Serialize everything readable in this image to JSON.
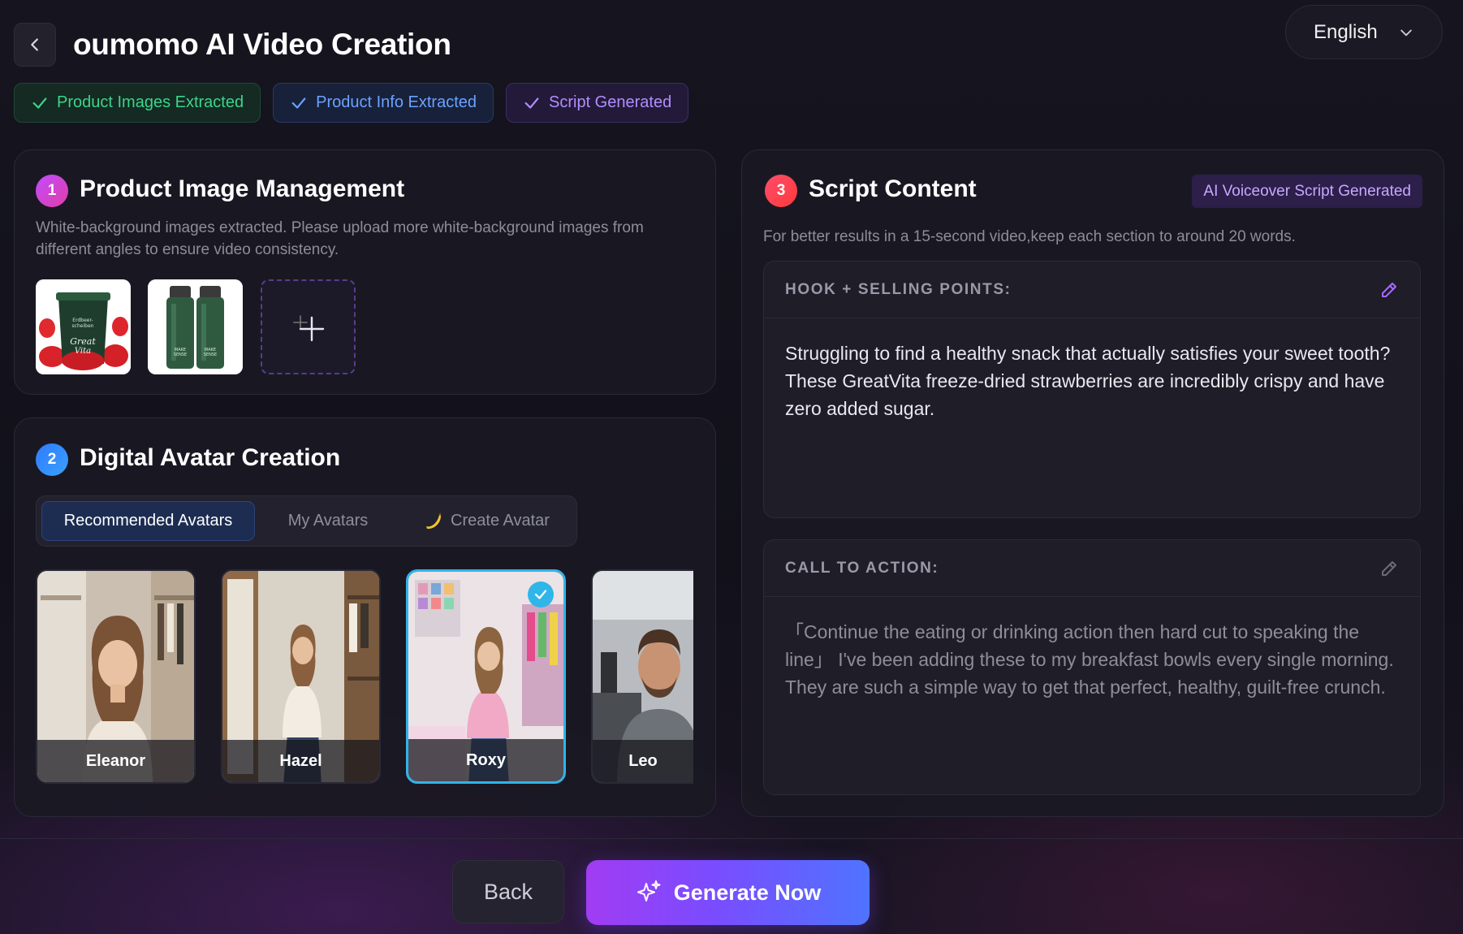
{
  "header": {
    "title": "oumomo AI Video Creation",
    "language": "English"
  },
  "status": [
    {
      "label": "Product Images Extracted",
      "color": "#3ed38a"
    },
    {
      "label": "Product Info Extracted",
      "color": "#6aa2ff"
    },
    {
      "label": "Script Generated",
      "color": "#b48cff"
    }
  ],
  "product_images": {
    "step": "1",
    "title": "Product Image Management",
    "description": "White-background images extracted. Please upload more white-background images from different angles to ensure video consistency.",
    "images": [
      {
        "name": "strawberry-bucket",
        "label": "Great Vita"
      },
      {
        "name": "green-bottles",
        "label": "MAKE SENSE"
      }
    ]
  },
  "avatar_creation": {
    "step": "2",
    "title": "Digital Avatar Creation",
    "tabs": [
      "Recommended Avatars",
      "My Avatars",
      "Create Avatar"
    ],
    "avatars": [
      {
        "name": "Eleanor",
        "selected": false
      },
      {
        "name": "Hazel",
        "selected": false
      },
      {
        "name": "Roxy",
        "selected": true
      },
      {
        "name": "Leo",
        "selected": false
      }
    ]
  },
  "script": {
    "step": "3",
    "title": "Script Content",
    "tag": "AI Voiceover Script Generated",
    "hint": "For better results in a 15-second video,keep each section to around 20 words.",
    "sections": [
      {
        "label": "HOOK + SELLING POINTS:",
        "text": "Struggling to find a healthy snack that actually satisfies your sweet tooth? These GreatVita freeze-dried strawberries are incredibly crispy and have zero added sugar."
      },
      {
        "label": "CALL TO ACTION:",
        "text": "「Continue the eating or drinking action then hard cut to speaking the line」 I've been adding these to my breakfast bowls every single morning. They are such a simple way to get that perfect, healthy, guilt-free crunch."
      }
    ]
  },
  "footer": {
    "back_label": "Back",
    "generate_label": "Generate Now"
  },
  "colors": {
    "accent_purple": "#a13cf2",
    "accent_blue": "#4f74ff",
    "selected_border": "#2fb5e8"
  }
}
